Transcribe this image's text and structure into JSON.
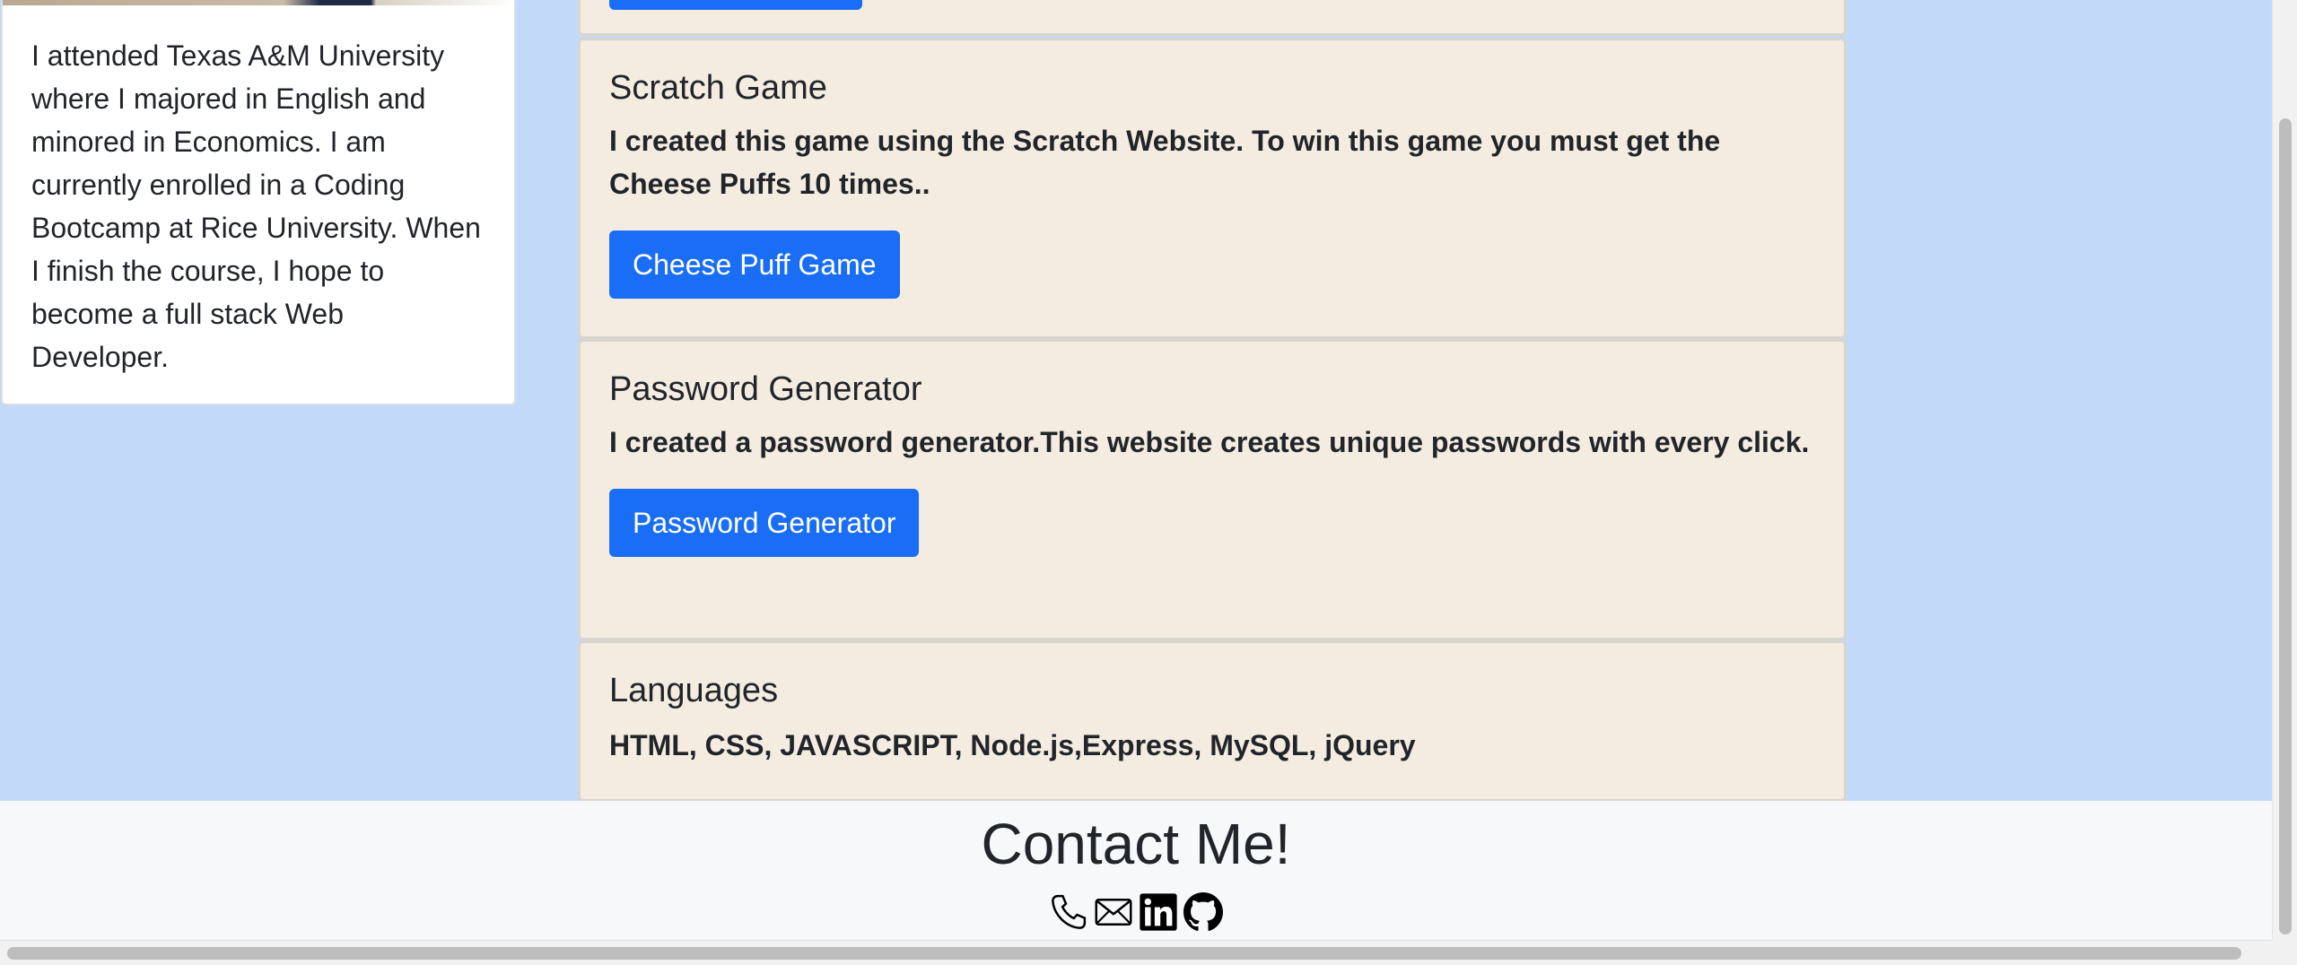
{
  "about": {
    "text": "I attended Texas A&M University where I majored in English and minored in Economics. I am currently enrolled in a Coding Bootcamp at Rice University. When I finish the course, I hope to become a full stack Web Developer."
  },
  "projects": [
    {
      "title": "Scratch Game",
      "description": "I created this game using the Scratch Website. To win this game you must get the Cheese Puffs 10 times..",
      "button_label": "Cheese Puff Game"
    },
    {
      "title": "Password Generator",
      "description": "I created a password generator.This website creates unique passwords with every click.",
      "button_label": "Password Generator"
    }
  ],
  "languages": {
    "title": "Languages",
    "list": "HTML, CSS, JAVASCRIPT, Node.js,Express, MySQL, jQuery"
  },
  "contact": {
    "title": "Contact Me!",
    "icons": [
      "phone-icon",
      "email-icon",
      "linkedin-icon",
      "github-icon"
    ]
  },
  "colors": {
    "page_background": "#c2d9fa",
    "card_background": "#f4ece1",
    "button_primary": "#1a6ef5",
    "footer_background": "#f7f8fa"
  }
}
